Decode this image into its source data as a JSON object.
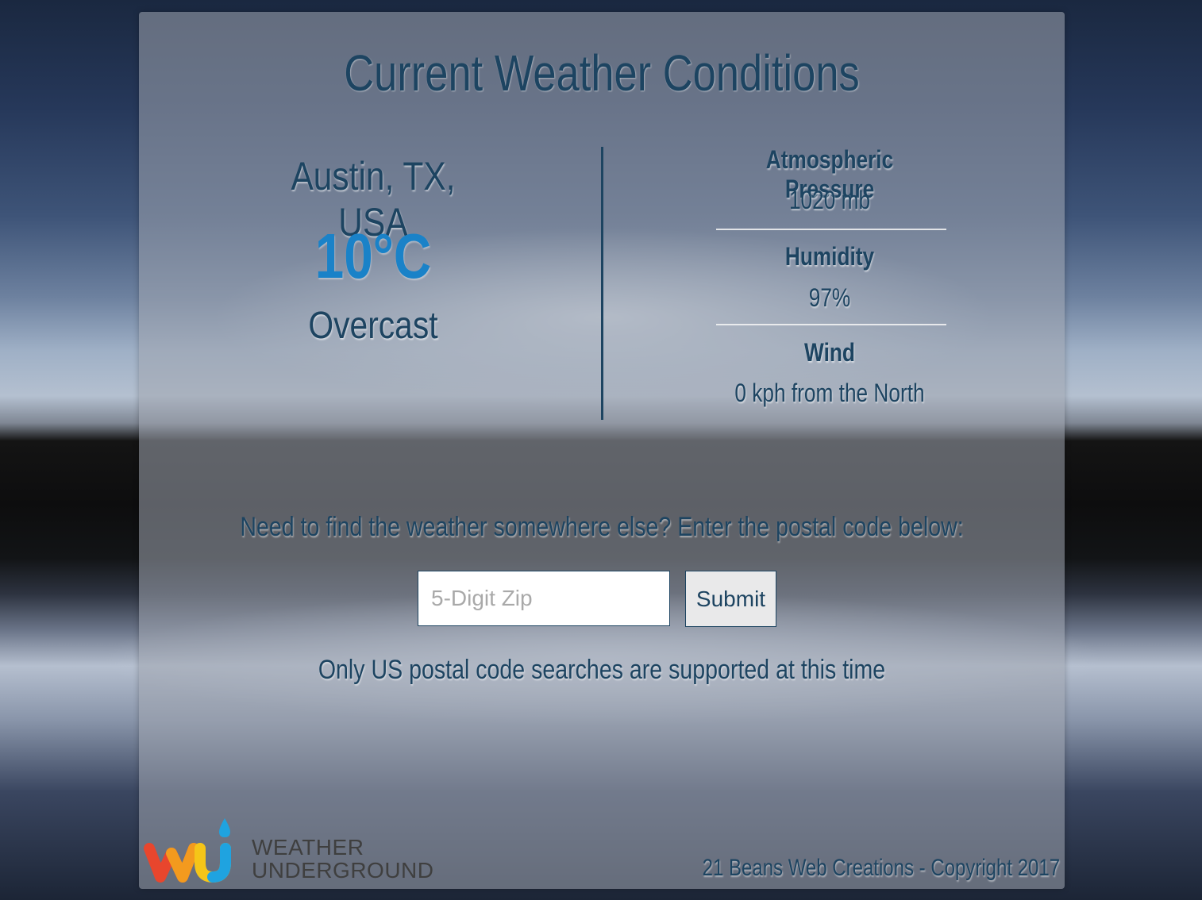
{
  "page": {
    "title": "Current Weather Conditions"
  },
  "current": {
    "location": "Austin, TX, USA",
    "temperature": "10°C",
    "condition": "Overcast"
  },
  "stats": {
    "pressure": {
      "label": "Atmospheric Pressure",
      "value": "1020 mb"
    },
    "humidity": {
      "label": "Humidity",
      "value": "97%"
    },
    "wind": {
      "label": "Wind",
      "value": "0 kph from the North"
    }
  },
  "search": {
    "prompt": "Need to find the weather somewhere else? Enter the postal code below:",
    "placeholder": "5-Digit Zip",
    "submit_label": "Submit",
    "note": "Only US postal code searches are supported at this time"
  },
  "footer": {
    "logo_text_line1": "WEATHER",
    "logo_text_line2": "UNDERGROUND",
    "copyright": "21 Beans Web Creations - Copyright 2017"
  },
  "colors": {
    "heading": "#1d4461",
    "temperature": "#1a82c8"
  }
}
